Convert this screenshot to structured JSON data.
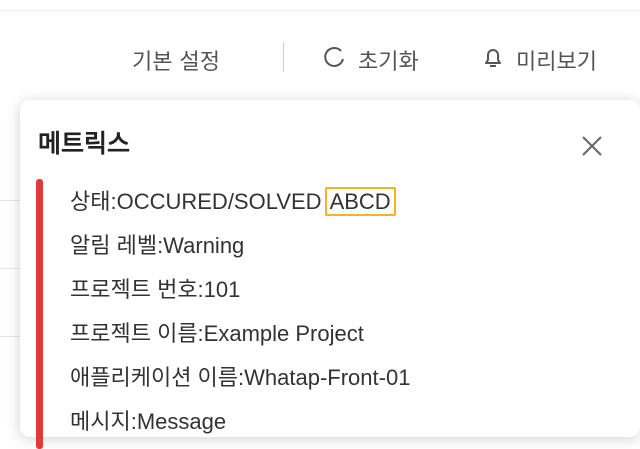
{
  "toolbar": {
    "basic_settings": "기본 설정",
    "reset": "초기화",
    "preview": "미리보기"
  },
  "popup": {
    "title": "메트릭스",
    "accent_color": "#e53935",
    "lines": {
      "status_label": "상태:OCCURED/SOLVED",
      "status_highlight": "ABCD",
      "alert_level": "알림 레벨:Warning",
      "project_no": "프로젝트 번호:101",
      "project_name": "프로젝트 이름:Example Project",
      "app_name": "애플리케이션 이름:Whatap-Front-01",
      "message": "메시지:Message"
    }
  },
  "icons": {
    "reset": "refresh-icon",
    "preview": "bell-icon",
    "close": "close-icon"
  }
}
